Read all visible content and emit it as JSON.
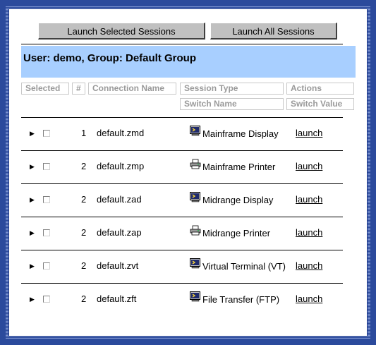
{
  "toolbar": {
    "launch_selected_label": "Launch Selected Sessions",
    "launch_all_label": "Launch All Sessions"
  },
  "user_bar": {
    "text": "User: demo, Group: Default Group"
  },
  "table": {
    "headers": {
      "selected": "Selected",
      "number": "#",
      "connection_name": "Connection Name",
      "session_type": "Session Type",
      "actions": "Actions",
      "switch_name": "Switch Name",
      "switch_value": "Switch Value"
    },
    "rows": [
      {
        "number": "1",
        "name": "default.zmd",
        "type": "Mainframe Display",
        "icon": "display-icon",
        "action": "launch"
      },
      {
        "number": "2",
        "name": "default.zmp",
        "type": "Mainframe Printer",
        "icon": "printer-icon",
        "action": "launch"
      },
      {
        "number": "2",
        "name": "default.zad",
        "type": "Midrange Display",
        "icon": "display-icon",
        "action": "launch"
      },
      {
        "number": "2",
        "name": "default.zap",
        "type": "Midrange Printer",
        "icon": "printer-icon",
        "action": "launch"
      },
      {
        "number": "2",
        "name": "default.zvt",
        "type": "Virtual Terminal (VT)",
        "icon": "display-icon",
        "action": "launch"
      },
      {
        "number": "2",
        "name": "default.zft",
        "type": "File Transfer (FTP)",
        "icon": "display-icon",
        "action": "launch"
      }
    ]
  },
  "colors": {
    "frame": "#2b4a9c",
    "user_bar_bg": "#a8cfff",
    "header_text": "#9a9a9a",
    "button_bg": "#c0c0c0"
  }
}
